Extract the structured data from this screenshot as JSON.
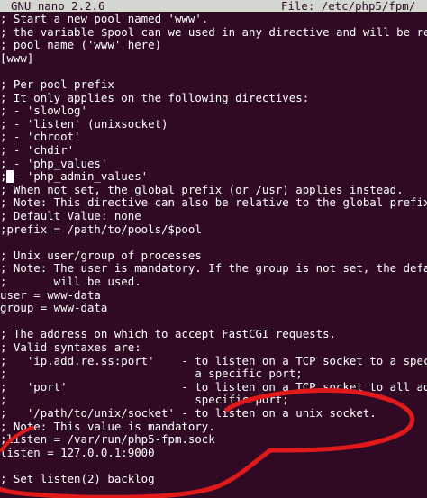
{
  "titlebar": {
    "app": "GNU nano 2.2.6",
    "file": "File: /etc/php5/fpm/"
  },
  "editor": {
    "lines": [
      "; Start a new pool named 'www'.",
      "; the variable $pool can we used in any directive and will be rep",
      "; pool name ('www' here)",
      "[www]",
      "",
      "; Per pool prefix",
      "; It only applies on the following directives:",
      "; - 'slowlog'",
      "; - 'listen' (unixsocket)",
      "; - 'chroot'",
      "; - 'chdir'",
      "; - 'php_values'",
      "; - 'php_admin_values'",
      "; When not set, the global prefix (or /usr) applies instead.",
      "; Note: This directive can also be relative to the global prefix",
      "; Default Value: none",
      ";prefix = /path/to/pools/$pool",
      "",
      "; Unix user/group of processes",
      "; Note: The user is mandatory. If the group is not set, the defau",
      ";       will be used.",
      "user = www-data",
      "group = www-data",
      "",
      "; The address on which to accept FastCGI requests.",
      "; Valid syntaxes are:",
      ";   'ip.add.re.ss:port'    - to listen on a TCP socket to a speci",
      ";                            a specific port;",
      ";   'port'                 - to listen on a TCP socket to all add",
      ";                            specific port;",
      ";   '/path/to/unix/socket' - to listen on a unix socket.",
      "; Note: This value is mandatory.",
      ";listen = /var/run/php5-fpm.sock",
      "listen = 127.0.0.1:9000",
      "",
      "; Set listen(2) backlog"
    ]
  },
  "annotation": {
    "ring_color": "#e0191b"
  },
  "cursor": {
    "line_index": 12,
    "char_index": 1
  }
}
